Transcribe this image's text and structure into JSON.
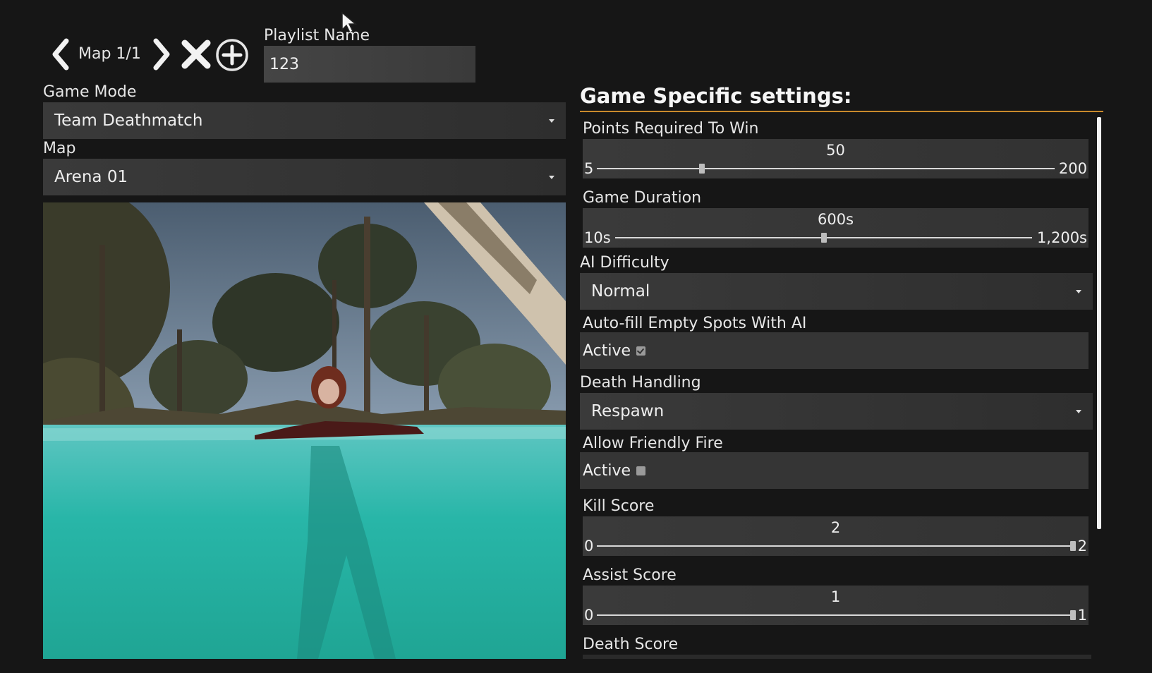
{
  "nav": {
    "map_counter": "Map 1/1",
    "icons": [
      "chevron-left-icon",
      "chevron-right-icon",
      "close-icon",
      "add-circle-icon"
    ]
  },
  "playlist": {
    "label": "Playlist Name",
    "value": "123"
  },
  "game_mode": {
    "label": "Game Mode",
    "value": "Team Deathmatch"
  },
  "map": {
    "label": "Map",
    "value": "Arena 01"
  },
  "settings": {
    "title": "Game Specific settings:",
    "accent_color": "#c98a2b",
    "points_to_win": {
      "label": "Points Required To Win",
      "value": "50",
      "min": "5",
      "max": "200",
      "fraction": 0.23
    },
    "game_duration": {
      "label": "Game Duration",
      "value": "600s",
      "min": "10s",
      "max": "1,200s",
      "fraction": 0.5
    },
    "ai_difficulty": {
      "label": "AI Difficulty",
      "value": "Normal"
    },
    "autofill": {
      "label": "Auto-fill Empty Spots With AI",
      "state_label": "Active",
      "checked": true
    },
    "death_handling": {
      "label": "Death Handling",
      "value": "Respawn"
    },
    "friendly_fire": {
      "label": "Allow Friendly Fire",
      "state_label": "Active",
      "checked": false
    },
    "kill_score": {
      "label": "Kill Score",
      "value": "2",
      "min": "0",
      "max": "2",
      "fraction": 1.0
    },
    "assist_score": {
      "label": "Assist Score",
      "value": "1",
      "min": "0",
      "max": "1",
      "fraction": 1.0
    },
    "death_score": {
      "label": "Death Score"
    }
  }
}
